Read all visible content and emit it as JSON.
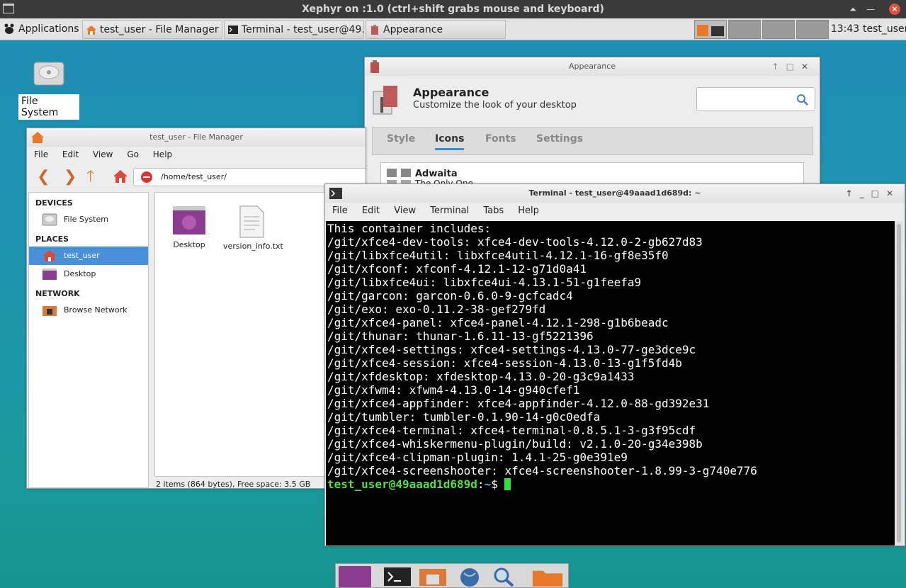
{
  "xephyr": {
    "title": "Xephyr on :1.0 (ctrl+shift grabs mouse and keyboard)"
  },
  "panel": {
    "applications_label": "Applications",
    "tasks": [
      {
        "label": "test_user - File Manager"
      },
      {
        "label": "Terminal - test_user@49..."
      },
      {
        "label": "Appearance"
      }
    ],
    "clock": "13:43",
    "user": "test_user"
  },
  "desktop": {
    "filesystem_label": "File System"
  },
  "appearance": {
    "window_title": "Appearance",
    "title": "Appearance",
    "subtitle": "Customize the look of your desktop",
    "tabs": [
      {
        "label": "Style"
      },
      {
        "label": "Icons"
      },
      {
        "label": "Fonts"
      },
      {
        "label": "Settings"
      }
    ],
    "active_tab": "Icons",
    "theme_name": "Adwaita",
    "theme_desc": "The Only One"
  },
  "file_manager": {
    "window_title": "test_user - File Manager",
    "menu": [
      "File",
      "Edit",
      "View",
      "Go",
      "Help"
    ],
    "path": "/home/test_user/",
    "sidebar": {
      "devices_header": "DEVICES",
      "devices": [
        {
          "label": "File System"
        }
      ],
      "places_header": "PLACES",
      "places": [
        {
          "label": "test_user"
        },
        {
          "label": "Desktop"
        }
      ],
      "network_header": "NETWORK",
      "network": [
        {
          "label": "Browse Network"
        }
      ]
    },
    "items": [
      {
        "label": "Desktop"
      },
      {
        "label": "version_info.txt"
      }
    ],
    "status": "2 items (864 bytes), Free space: 3.5 GB"
  },
  "terminal": {
    "window_title": "Terminal - test_user@49aaad1d689d: ~",
    "menu": [
      "File",
      "Edit",
      "View",
      "Terminal",
      "Tabs",
      "Help"
    ],
    "lines": [
      "This container includes:",
      "/git/xfce4-dev-tools: xfce4-dev-tools-4.12.0-2-gb627d83",
      "/git/libxfce4util: libxfce4util-4.12.1-16-gf8e35f0",
      "/git/xfconf: xfconf-4.12.1-12-g71d0a41",
      "/git/libxfce4ui: libxfce4ui-4.13.1-51-g1feefa9",
      "/git/garcon: garcon-0.6.0-9-gcfcadc4",
      "/git/exo: exo-0.11.2-38-gef279fd",
      "/git/xfce4-panel: xfce4-panel-4.12.1-298-g1b6beadc",
      "/git/thunar: thunar-1.6.11-13-gf5221396",
      "/git/xfce4-settings: xfce4-settings-4.13.0-77-ge3dce9c",
      "/git/xfce4-session: xfce4-session-4.13.0-13-g1f5fd4b",
      "/git/xfdesktop: xfdesktop-4.13.0-20-g3c9a1433",
      "/git/xfwm4: xfwm4-4.13.0-14-g940cfef1",
      "/git/xfce4-appfinder: xfce4-appfinder-4.12.0-88-gd392e31",
      "/git/tumbler: tumbler-0.1.90-14-g0c0edfa",
      "/git/xfce4-terminal: xfce4-terminal-0.8.5.1-3-g3f95cdf",
      "/git/xfce4-whiskermenu-plugin/build: v2.1.0-20-g34e398b",
      "/git/xfce4-clipman-plugin: 1.4.1-25-g0e391e9",
      "/git/xfce4-screenshooter: xfce4-screenshooter-1.8.99-3-g740e776"
    ],
    "prompt_user": "test_user@49aaad1d689d",
    "prompt_sep": ":",
    "prompt_path": "~",
    "prompt_symbol": "$ "
  },
  "colors": {
    "accent": "#4a90d9",
    "prompt_user": "#55e040",
    "prompt_path": "#5aa0ff"
  }
}
